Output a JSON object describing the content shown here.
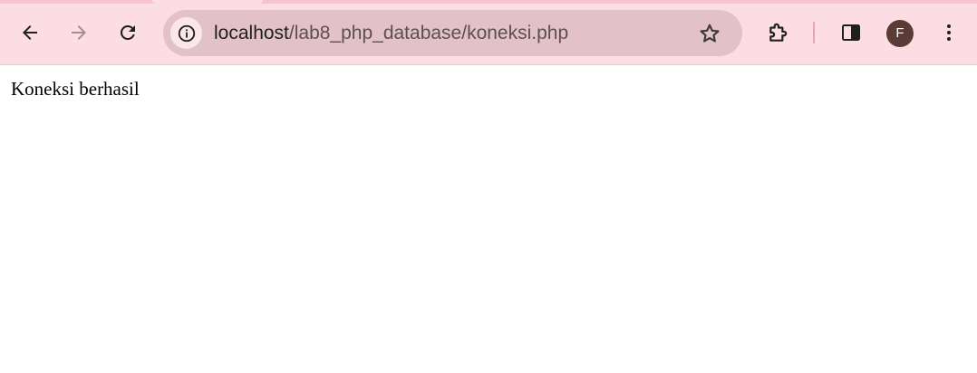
{
  "browser": {
    "address_bar": {
      "host": "localhost",
      "path": "/lab8_php_database/koneksi.php"
    },
    "profile": {
      "initial": "F"
    },
    "icons": {
      "back": "back-arrow-icon",
      "forward": "forward-arrow-icon",
      "reload": "reload-icon",
      "site_info": "info-icon",
      "bookmark": "star-icon",
      "extensions": "puzzle-piece-icon",
      "side_panel": "side-panel-icon",
      "menu": "kebab-menu-icon"
    },
    "colors": {
      "toolbar_bg": "#fcdde3",
      "omnibox_bg": "#e2c2c8",
      "avatar_bg": "#5a3b35",
      "disabled_icon": "#a88b91"
    }
  },
  "page": {
    "body_text": "Koneksi berhasil"
  }
}
